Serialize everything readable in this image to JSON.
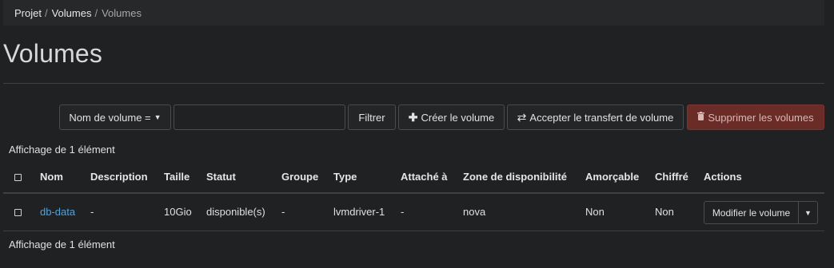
{
  "breadcrumb": {
    "items": [
      "Projet",
      "Volumes",
      "Volumes"
    ],
    "separator": "/"
  },
  "page_title": "Volumes",
  "toolbar": {
    "filter_field_label": "Nom de volume =",
    "filter_field_icon": "caret-down-icon",
    "filter_input_value": "",
    "filter_label": "Filtrer",
    "create_label": "Créer le volume",
    "create_icon": "+",
    "accept_label": "Accepter le transfert de volume",
    "accept_icon": "⇄",
    "delete_label": "Supprimer les volumes",
    "delete_icon": "trash-icon"
  },
  "count_text": "Affichage de 1 élément",
  "table": {
    "columns": [
      "Nom",
      "Description",
      "Taille",
      "Statut",
      "Groupe",
      "Type",
      "Attaché à",
      "Zone de disponibilité",
      "Amorçable",
      "Chiffré",
      "Actions"
    ],
    "rows": [
      {
        "name": "db-data",
        "description": "-",
        "size": "10Gio",
        "status": "disponible(s)",
        "group": "-",
        "type": "lvmdriver-1",
        "attached": "-",
        "zone": "nova",
        "bootable": "Non",
        "encrypted": "Non",
        "action": "Modifier le volume"
      }
    ]
  },
  "colors": {
    "background": "#1f2123",
    "link": "#4ea3dd",
    "danger": "#6b2b27"
  }
}
